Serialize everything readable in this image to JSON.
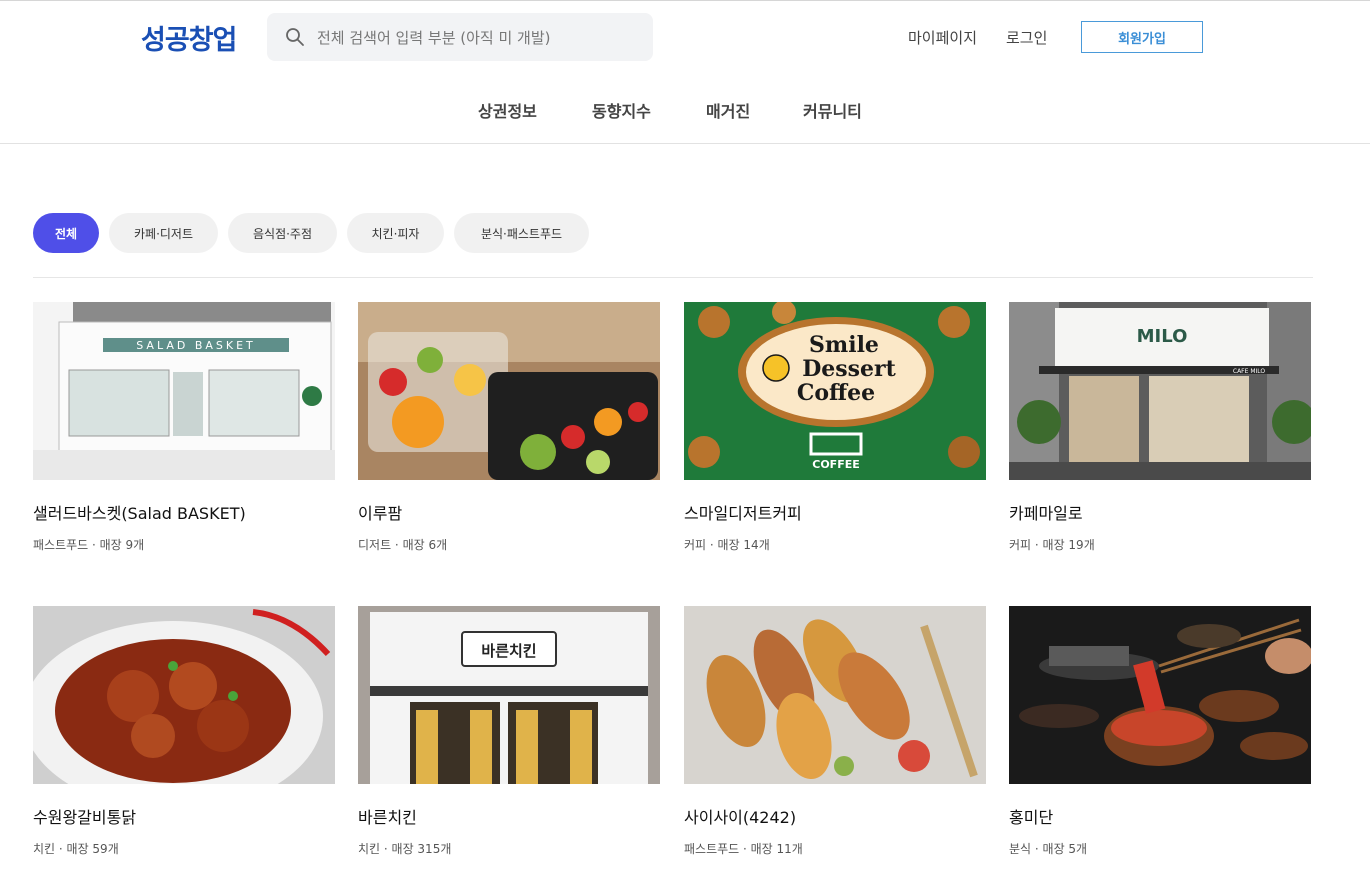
{
  "header": {
    "logo": "성공창업",
    "search_placeholder": "전체 검색어 입력 부분 (아직 미 개발)",
    "mypage": "마이페이지",
    "login": "로그인",
    "signup": "회원가입"
  },
  "nav": [
    "상권정보",
    "동향지수",
    "매거진",
    "커뮤니티"
  ],
  "filters": {
    "active": "전체",
    "items": [
      "전체",
      "카페·디저트",
      "음식점·주점",
      "치킨·피자",
      "분식·패스트푸드"
    ]
  },
  "brands": [
    {
      "name": "샐러드바스켓(Salad BASKET)",
      "meta": "패스트푸드 · 매장 9개",
      "image_text": "SALAD BASKET"
    },
    {
      "name": "이루팜",
      "meta": "디저트 · 매장 6개"
    },
    {
      "name": "스마일디저트커피",
      "meta": "커피 · 매장 14개",
      "image_text": [
        "Smile",
        "Dessert",
        "Coffee",
        "COFFEE"
      ]
    },
    {
      "name": "카페마일로",
      "meta": "커피 · 매장 19개",
      "image_text": [
        "MILO",
        "CAFE MILO"
      ]
    },
    {
      "name": "수원왕갈비통닭",
      "meta": "치킨 · 매장 59개"
    },
    {
      "name": "바른치킨",
      "meta": "치킨 · 매장 315개",
      "image_text": "바른치킨"
    },
    {
      "name": "사이사이(4242)",
      "meta": "패스트푸드 · 매장 11개"
    },
    {
      "name": "홍미단",
      "meta": "분식 · 매장 5개"
    }
  ],
  "colors": {
    "brand": "#1a4fb4",
    "accent": "#4f4fe8",
    "signup_border": "#4a9ad9"
  }
}
